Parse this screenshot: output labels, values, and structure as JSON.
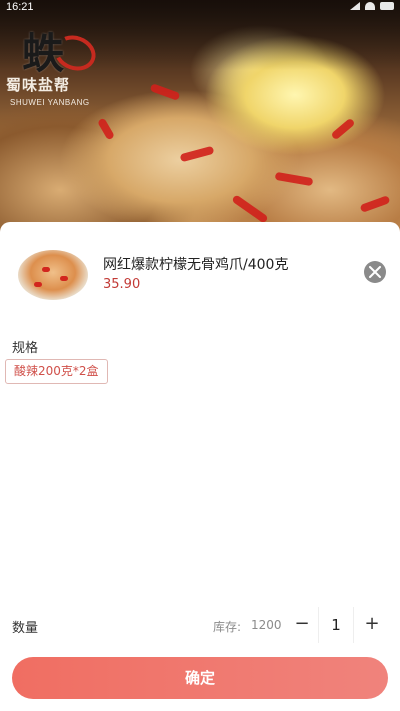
{
  "status_bar": {
    "time": "16:21"
  },
  "brand": {
    "glyph": "蛈",
    "name": "蜀味盐帮",
    "sub": "SHUWEI YANBANG"
  },
  "product": {
    "title": "网红爆款柠檬无骨鸡爪/400克",
    "price": "35.90"
  },
  "spec": {
    "label": "规格",
    "options": [
      "酸辣200克*2盒"
    ],
    "selected_index": 0
  },
  "quantity": {
    "label": "数量",
    "stock_label": "库存:",
    "stock_value": "1200",
    "minus": "−",
    "plus": "+",
    "value": "1"
  },
  "actions": {
    "confirm": "确定"
  },
  "colors": {
    "accent": "#f0766c",
    "price": "#c23a36",
    "spec_border": "#e0b8b4"
  },
  "icons": {
    "close": "close-icon"
  }
}
